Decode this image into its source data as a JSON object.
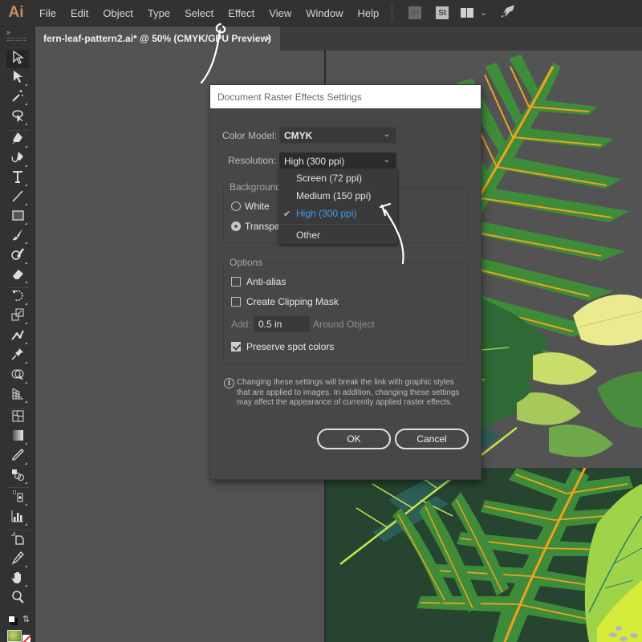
{
  "app": {
    "logo": "Ai",
    "menu": [
      "File",
      "Edit",
      "Object",
      "Type",
      "Select",
      "Effect",
      "View",
      "Window",
      "Help"
    ],
    "badges": {
      "bridge": "Br",
      "stock": "St"
    },
    "icons": [
      "workspace-switcher-icon",
      "chevron-down-icon",
      "rocket-icon"
    ]
  },
  "tabs": {
    "collapse_label": "››",
    "document": {
      "title": "fern-leaf-pattern2.ai* @ 50% (CMYK/GPU Preview)",
      "close_label": "✕"
    }
  },
  "toolbar": {
    "tools": [
      "selection-tool",
      "direct-selection-tool",
      "magic-wand-tool",
      "lasso-tool",
      "pen-tool",
      "curvature-tool",
      "type-tool",
      "line-segment-tool",
      "rectangle-tool",
      "paintbrush-tool",
      "shaper-tool",
      "eraser-tool",
      "rotate-tool",
      "scale-tool",
      "puppet-warp-tool",
      "pin-tool",
      "shape-builder-tool",
      "perspective-grid-tool",
      "mesh-tool",
      "gradient-tool",
      "eyedropper-tool",
      "blend-tool",
      "symbol-sprayer-tool",
      "column-graph-tool",
      "artboard-tool",
      "slice-tool",
      "hand-tool",
      "zoom-tool"
    ]
  },
  "dialog": {
    "title": "Document Raster Effects Settings",
    "color_model": {
      "label": "Color Model:",
      "value": "CMYK"
    },
    "resolution": {
      "label": "Resolution:",
      "value": "High (300 ppi)",
      "options": [
        "Screen (72 ppi)",
        "Medium (150 ppi)",
        "High (300 ppi)",
        "Other"
      ],
      "selected_index": 2
    },
    "background": {
      "title": "Background",
      "options": [
        "White",
        "Transparent"
      ],
      "visible_labels": [
        "White",
        "Transpa"
      ],
      "selected": "Transparent"
    },
    "options": {
      "title": "Options",
      "anti_alias": {
        "label": "Anti-alias",
        "checked": false
      },
      "clipping_mask": {
        "label": "Create Clipping Mask",
        "checked": false
      },
      "add": {
        "label": "Add:",
        "value": "0.5 in",
        "suffix": "Around Object"
      },
      "preserve_spot": {
        "label": "Preserve spot colors",
        "checked": true
      }
    },
    "info": "Changing these settings will break the link with graphic styles that are applied to images. In addition, changing these settings may affect the appearance of currently applied raster effects.",
    "buttons": {
      "ok": "OK",
      "cancel": "Cancel"
    }
  },
  "colors": {
    "menubar_bg": "#323232",
    "canvas_bg": "#535353",
    "dialog_bg": "#474747",
    "selected_option": "#3e9cf0",
    "logo": "#d08a5a",
    "artboard_dark_green": "#26442f",
    "fern_green": "#3d8a3a",
    "fern_vein": "#f0a21c",
    "light_leaf": "#9fd34a",
    "pale_leaf": "#eaeb8f"
  }
}
